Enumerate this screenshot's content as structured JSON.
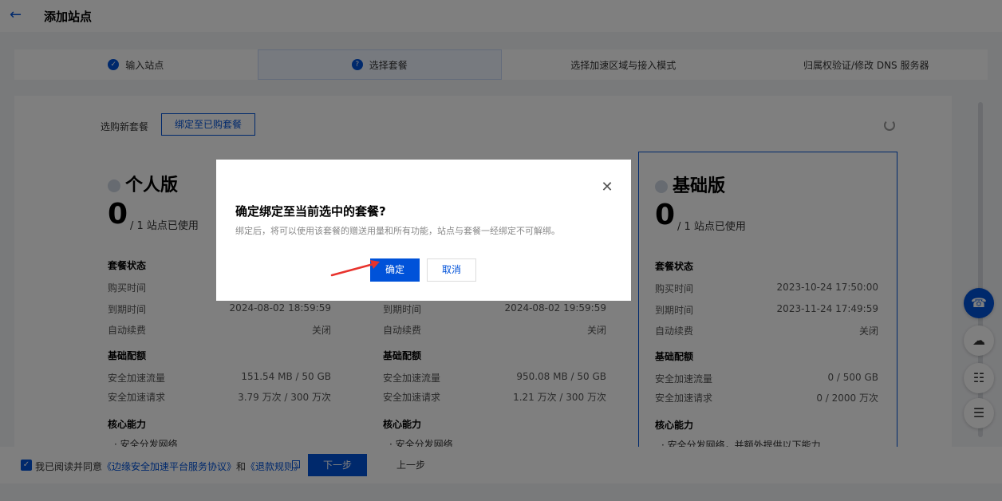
{
  "header": {
    "title": "添加站点"
  },
  "steps": [
    {
      "label": "输入站点",
      "state": "done",
      "icon": "check-icon"
    },
    {
      "label": "选择套餐",
      "state": "active",
      "icon": "question-icon",
      "icon_text": "?"
    },
    {
      "label": "选择加速区域与接入模式",
      "state": "pending"
    },
    {
      "label": "归属权验证/修改 DNS 服务器",
      "state": "pending"
    }
  ],
  "tabs": {
    "new": "选购新套餐",
    "bind": "绑定至已购套餐"
  },
  "plans": [
    {
      "name": "个人版",
      "used": "0",
      "used_label": "/ 1 站点已使用",
      "status_title": "套餐状态",
      "status_rows": [
        {
          "label": "购买时间",
          "value": ""
        },
        {
          "label": "到期时间",
          "value": "2024-08-02 18:59:59"
        },
        {
          "label": "自动续费",
          "value": "关闭"
        }
      ],
      "basic_title": "基础配额",
      "basic_rows": [
        {
          "label": "安全加速流量",
          "value": "151.54 MB / 50 GB"
        },
        {
          "label": "安全加速请求",
          "value": "3.79 万次 / 300 万次"
        }
      ],
      "core_title": "核心能力",
      "core_item": "· 安全分发网络"
    },
    {
      "name": "",
      "used": "",
      "used_label": "",
      "status_title": "",
      "status_rows": [
        {
          "label": "",
          "value": ""
        },
        {
          "label": "到期时间",
          "value": "2024-08-02 19:59:59"
        },
        {
          "label": "自动续费",
          "value": "关闭"
        }
      ],
      "basic_title": "基础配额",
      "basic_rows": [
        {
          "label": "安全加速流量",
          "value": "950.08 MB / 50 GB"
        },
        {
          "label": "安全加速请求",
          "value": "1.21 万次 / 300 万次"
        }
      ],
      "core_title": "核心能力",
      "core_item": "· 安全分发网络"
    },
    {
      "name": "基础版",
      "used": "0",
      "used_label": "/ 1 站点已使用",
      "status_title": "套餐状态",
      "status_rows": [
        {
          "label": "购买时间",
          "value": "2023-10-24 17:50:00"
        },
        {
          "label": "到期时间",
          "value": "2023-11-24 17:49:59"
        },
        {
          "label": "自动续费",
          "value": "关闭"
        }
      ],
      "basic_title": "基础配额",
      "basic_rows": [
        {
          "label": "安全加速流量",
          "value": "0 / 500 GB"
        },
        {
          "label": "安全加速请求",
          "value": "0 / 2000 万次"
        }
      ],
      "core_title": "核心能力",
      "core_item": "· 安全分发网络，并额外提供以下能力"
    }
  ],
  "footer": {
    "agree_prefix": "我已阅读并同意",
    "agree_link1": "《边缘安全加速平台服务协议》",
    "agree_and": "和",
    "agree_link2": "《退款规则》",
    "next": "下一步",
    "prev": "上一步"
  },
  "dialog": {
    "title": "确定绑定至当前选中的套餐?",
    "desc": "绑定后，将可以使用该套餐的赠送用量和所有功能，站点与套餐一经绑定不可解绑。",
    "confirm": "确定",
    "cancel": "取消"
  },
  "colors": {
    "primary": "#0052d9",
    "annotation_arrow": "#e8332d"
  }
}
